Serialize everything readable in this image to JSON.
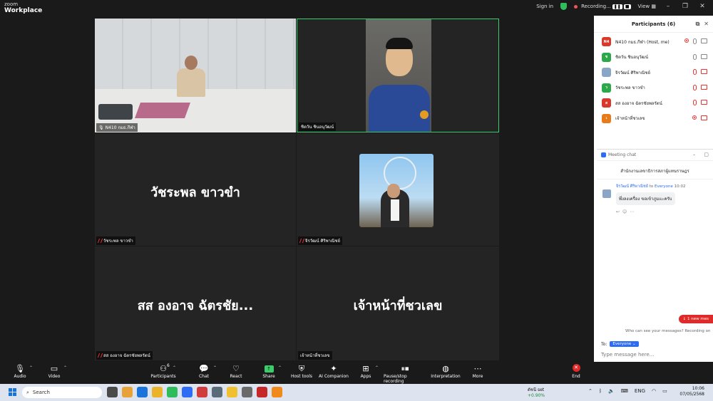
{
  "window": {
    "brand_top": "zoom",
    "brand_bottom": "Workplace",
    "sign_in": "Sign in",
    "recording": "Recording...",
    "view": "View",
    "min": "–",
    "max": "❐",
    "close": "✕"
  },
  "tiles": {
    "t1_name": "N410 กมธ.กีฬา",
    "t2_name": "ชิตวัน ชินอนุวัฒน์",
    "t3_big": "วัชระพล ขาวขำ",
    "t3_name": "วัชระพล ขาวขำ",
    "t4_name": "จิรวัฒน์ ศิริพาณิชย์",
    "t5_big": "สส องอาจ ฉัตรชัย...",
    "t5_name": "สส องอาจ ฉัตรชัยพลรัตน์",
    "t6_big": "เจ้าหน้าที่ชวเลข",
    "t6_name": "เจ้าหน้าที่ชวเลข"
  },
  "participants": {
    "title": "Participants (6)",
    "list": [
      {
        "initial": "N4",
        "color": "#d8392b",
        "name": "N410 กมธ.กีฬา (Host, me)"
      },
      {
        "initial": "ช",
        "color": "#2aa84a",
        "name": "ชิตวัน ชินอนุวัฒน์"
      },
      {
        "initial": "",
        "color": "#8aa6c6",
        "name": "จิรวัฒน์ ศิริพาณิชย์"
      },
      {
        "initial": "ว",
        "color": "#2aa84a",
        "name": "วัชระพล ขาวขำ"
      },
      {
        "initial": "ส",
        "color": "#d8392b",
        "name": "สส องอาจ ฉัตรชัยพลรัตน์"
      },
      {
        "initial": "เ",
        "color": "#e87a1a",
        "name": "เจ้าหน้าที่ชวเลข"
      }
    ]
  },
  "chat": {
    "title": "Meeting chat",
    "org": "สำนักงานเลขาธิการสภาผู้แทนราษฎร",
    "sender": "จิรวัฒน์ ศิริพาณิชย์",
    "to_word": "to",
    "recipient": "Everyone",
    "time": "10:02",
    "message": "พึ่งลงเครื่อง ขอเข้าภูมแะครับ",
    "new_message": "↓ 1 new mes",
    "who_can_see": "Who can see your messages? Recording on",
    "to_label": "To:",
    "to_value": "Everyone ⌄",
    "placeholder": "Type message here..."
  },
  "toolbar": {
    "audio": "Audio",
    "video": "Video",
    "participants": "Participants",
    "participants_count": "6",
    "chat": "Chat",
    "react": "React",
    "share": "Share",
    "host_tools": "Host tools",
    "ai": "AI Companion",
    "apps": "Apps",
    "pause": "Pause/stop recording",
    "interpretation": "Interpretation",
    "more": "More",
    "end": "End"
  },
  "taskbar": {
    "search": "Search",
    "stock_name": "ดัชนี set",
    "stock_change": "+0.90%",
    "lang": "ENG",
    "time": "10:06",
    "date": "07/05/2568"
  },
  "colors": {
    "accent": "#2d6cf5",
    "active_border": "#3acd6a",
    "end": "#e02a2a"
  }
}
